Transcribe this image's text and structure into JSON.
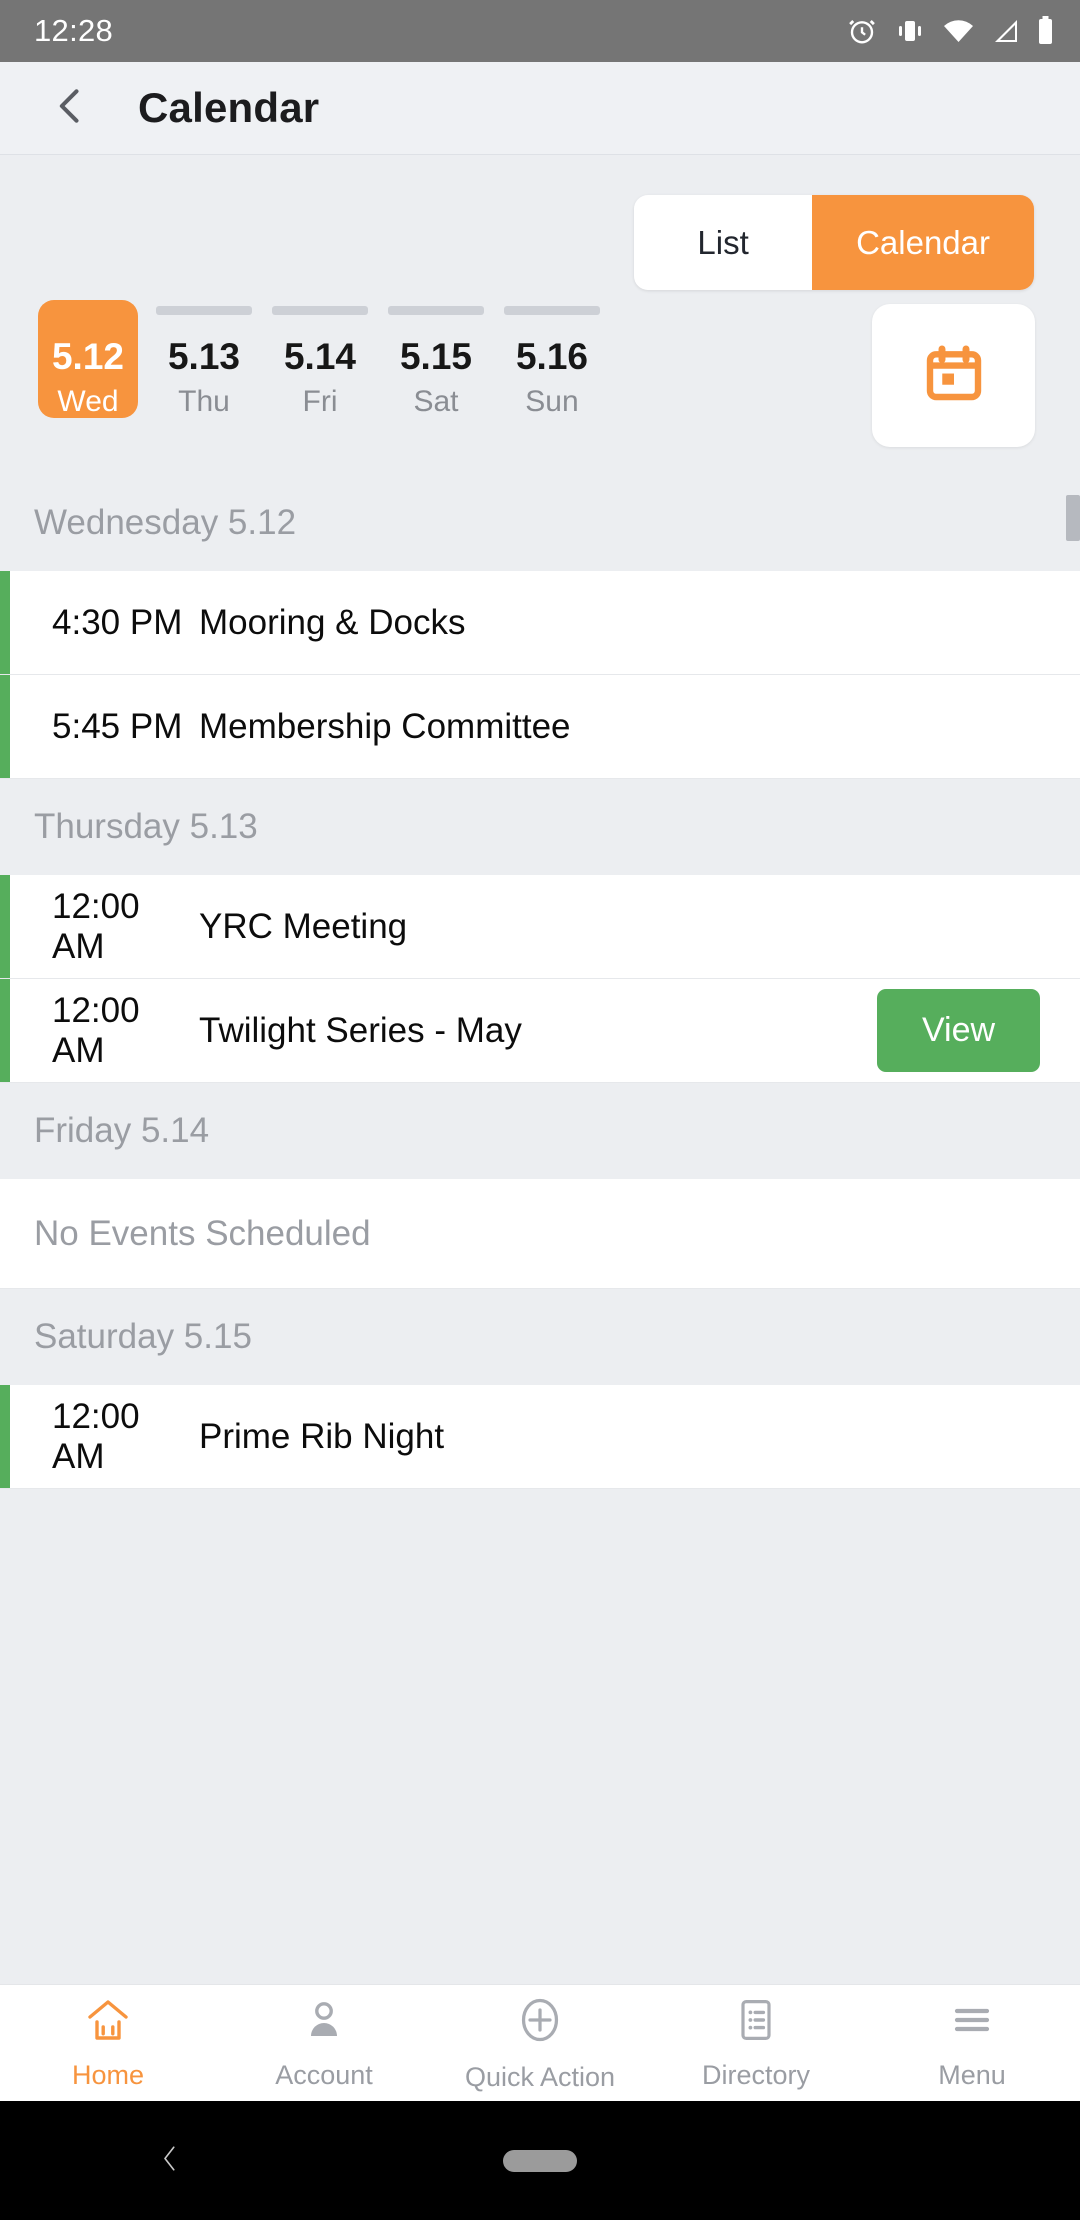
{
  "status_bar": {
    "time": "12:28",
    "icons": [
      "alarm-icon",
      "vibrate-icon",
      "wifi-icon",
      "signal-icon",
      "battery-icon"
    ]
  },
  "header": {
    "title": "Calendar",
    "back_icon": "chevron-left-icon"
  },
  "view_toggle": {
    "list_label": "List",
    "calendar_label": "Calendar",
    "selected": "Calendar",
    "active_color": "#F7943E"
  },
  "date_strip": {
    "picker_icon": "calendar-picker-icon",
    "selected_date": "5.12",
    "days": [
      {
        "date": "5.12",
        "weekday": "Wed",
        "selected": true
      },
      {
        "date": "5.13",
        "weekday": "Thu",
        "selected": false
      },
      {
        "date": "5.14",
        "weekday": "Fri",
        "selected": false
      },
      {
        "date": "5.15",
        "weekday": "Sat",
        "selected": false
      },
      {
        "date": "5.16",
        "weekday": "Sun",
        "selected": false
      }
    ]
  },
  "agenda": {
    "empty_label": "No Events Scheduled",
    "accent_color": "#56AE5C",
    "groups": [
      {
        "header": "Wednesday 5.12",
        "events": [
          {
            "time": "4:30 PM",
            "title": "Mooring & Docks",
            "action": null
          },
          {
            "time": "5:45 PM",
            "title": "Membership Committee",
            "action": null
          }
        ]
      },
      {
        "header": "Thursday 5.13",
        "events": [
          {
            "time": "12:00 AM",
            "title": "YRC Meeting",
            "action": null
          },
          {
            "time": "12:00 AM",
            "title": "Twilight Series - May",
            "action": "View"
          }
        ]
      },
      {
        "header": "Friday 5.14",
        "events": []
      },
      {
        "header": "Saturday 5.15",
        "events": [
          {
            "time": "12:00 AM",
            "title": "Prime Rib Night",
            "action": null
          }
        ]
      }
    ]
  },
  "tab_bar": {
    "active": "Home",
    "items": [
      {
        "label": "Home",
        "icon": "home-icon",
        "active": true
      },
      {
        "label": "Account",
        "icon": "person-icon",
        "active": false
      },
      {
        "label": "Quick Action",
        "icon": "plus-circle-icon",
        "active": false
      },
      {
        "label": "Directory",
        "icon": "list-document-icon",
        "active": false
      },
      {
        "label": "Menu",
        "icon": "hamburger-icon",
        "active": false
      }
    ]
  },
  "android_nav": {
    "back_icon": "nav-back-icon",
    "home_pill": "nav-home-pill"
  }
}
